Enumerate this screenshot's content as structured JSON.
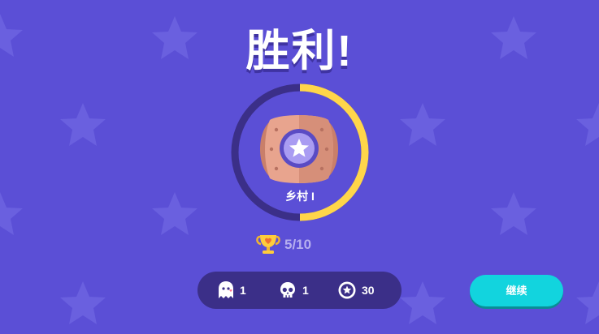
{
  "screen": {
    "title": "胜利!"
  },
  "rank": {
    "name": "乡村 I",
    "progress": 0.5,
    "ring_fill_color": "#ffd64a",
    "ring_track_color": "#3b2f88"
  },
  "trophies": {
    "icon": "trophy-heart-icon",
    "count_text": "5/10"
  },
  "stats": [
    {
      "icon": "ghost-icon",
      "value": "1"
    },
    {
      "icon": "skull-icon",
      "value": "1"
    },
    {
      "icon": "star-coin-icon",
      "value": "30"
    }
  ],
  "actions": {
    "continue_label": "继续"
  },
  "colors": {
    "background": "#5b4fd6",
    "accent": "#12d4de"
  }
}
